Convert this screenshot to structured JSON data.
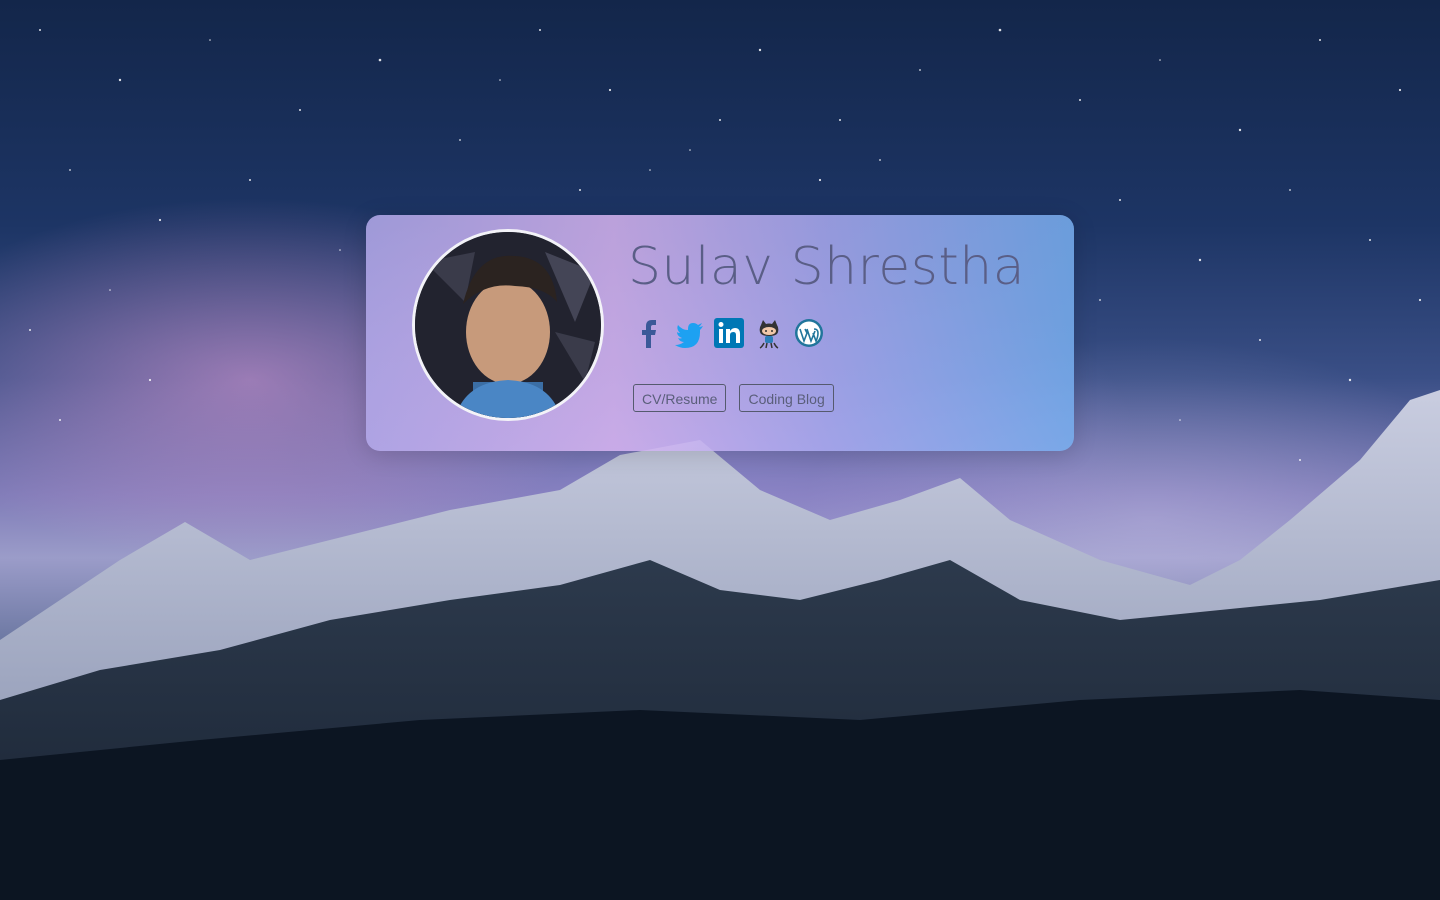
{
  "profile": {
    "name": "Sulav Shrestha",
    "avatar_alt": "profile-photo"
  },
  "social_links": [
    {
      "name": "facebook-icon",
      "color": "#3b5998"
    },
    {
      "name": "twitter-icon",
      "color": "#1da1f2"
    },
    {
      "name": "linkedin-icon",
      "color": "#0077b5"
    },
    {
      "name": "github-octocat-icon",
      "color": "#333333"
    },
    {
      "name": "wordpress-icon",
      "color": "#21759b"
    }
  ],
  "buttons": {
    "cv_label": "CV/Resume",
    "blog_label": "Coding Blog"
  },
  "colors": {
    "card_gradient": [
      "#b4aaeb",
      "#d7b4f0",
      "#aaaaf0",
      "#78aff0"
    ],
    "name_text": "#5a5e86"
  }
}
